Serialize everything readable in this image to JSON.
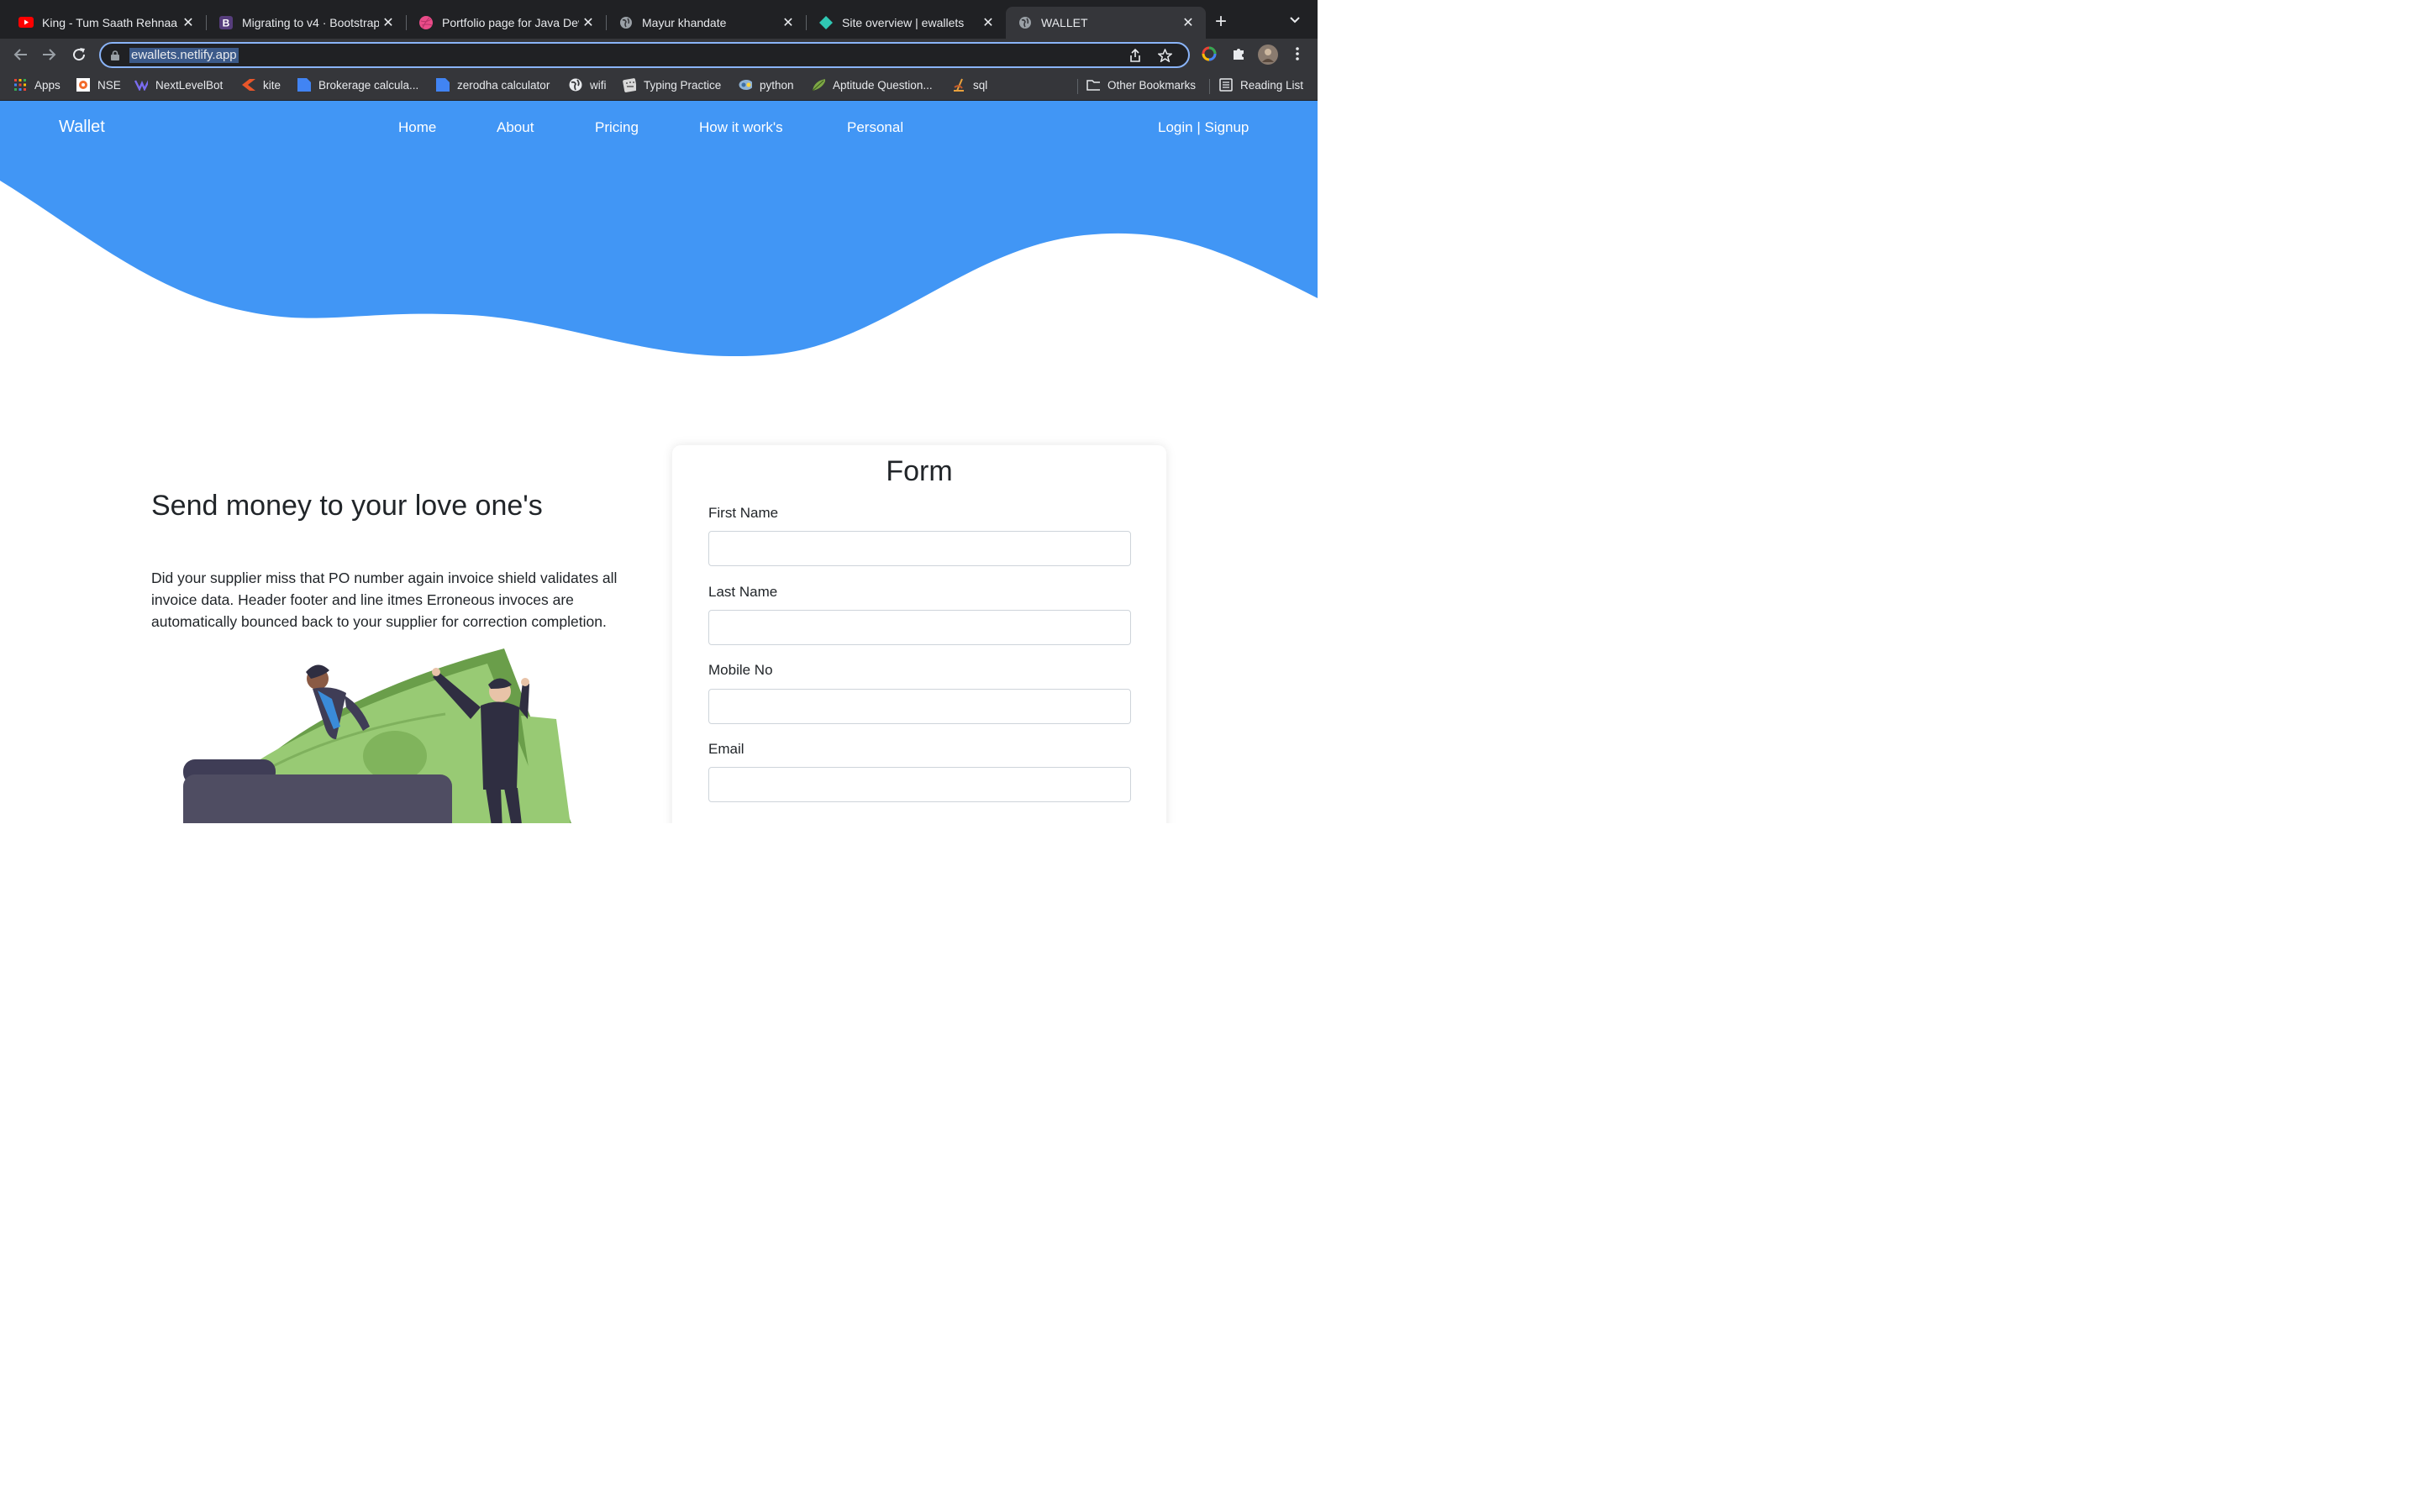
{
  "browser": {
    "tabs": [
      {
        "title": "King - Tum Saath Rehnaa (C",
        "favicon": "youtube-icon"
      },
      {
        "title": "Migrating to v4 · Bootstrap",
        "favicon": "bootstrap-icon"
      },
      {
        "title": "Portfolio page for Java Dev",
        "favicon": "dribbble-icon"
      },
      {
        "title": "Mayur khandate",
        "favicon": "globe-icon"
      },
      {
        "title": "Site overview | ewallets",
        "favicon": "netlify-icon"
      },
      {
        "title": "WALLET",
        "favicon": "globe-icon"
      }
    ],
    "url": "ewallets.netlify.app",
    "bookmarks": [
      "Apps",
      "NSE",
      "NextLevelBot",
      "kite",
      "Brokerage calcula...",
      "zerodha calculator",
      "wifi",
      "Typing Practice",
      "python",
      "Aptitude Question...",
      "sql"
    ],
    "other_bookmarks": "Other Bookmarks",
    "reading_list": "Reading List"
  },
  "site": {
    "brand": "Wallet",
    "nav": [
      "Home",
      "About",
      "Pricing",
      "How it work's",
      "Personal"
    ],
    "auth": "Login | Signup",
    "accent_color": "#4196f5"
  },
  "hero": {
    "title": "Send money to your love one's",
    "text": "Did your supplier miss that PO number again invoice shield validates all invoice data. Header footer and line itmes Erroneous invoces are automatically bounced back to your supplier for correction completion."
  },
  "form": {
    "title": "Form",
    "fields": [
      {
        "label": "First Name",
        "value": ""
      },
      {
        "label": "Last Name",
        "value": ""
      },
      {
        "label": "Mobile No",
        "value": ""
      },
      {
        "label": "Email",
        "value": ""
      }
    ]
  }
}
